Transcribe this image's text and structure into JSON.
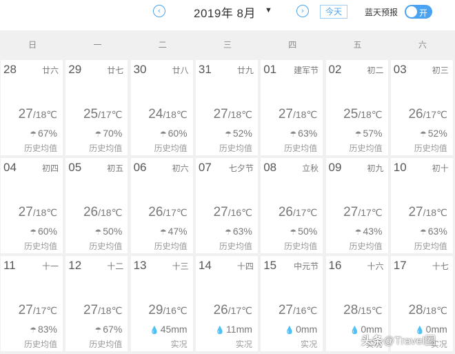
{
  "header": {
    "month_title": "2019年 8月",
    "caret": "▼",
    "prev_icon": "‹",
    "next_icon": "›",
    "today_label": "今天",
    "bluesky_label": "蓝天预报",
    "toggle_label": "开",
    "toggle_on": true,
    "accent_color": "#4aa3f0"
  },
  "weekdays": [
    "日",
    "一",
    "二",
    "三",
    "四",
    "五",
    "六"
  ],
  "precip_icons": {
    "chance": "☂",
    "amount": "💧"
  },
  "calendar": [
    {
      "day": "28",
      "lunar": "廿六",
      "hi": "27",
      "lo": "/18℃",
      "precip": "67%",
      "note": "历史均值",
      "kind": "chance"
    },
    {
      "day": "29",
      "lunar": "廿七",
      "hi": "25",
      "lo": "/17℃",
      "precip": "70%",
      "note": "历史均值",
      "kind": "chance"
    },
    {
      "day": "30",
      "lunar": "廿八",
      "hi": "24",
      "lo": "/18℃",
      "precip": "60%",
      "note": "历史均值",
      "kind": "chance"
    },
    {
      "day": "31",
      "lunar": "廿九",
      "hi": "27",
      "lo": "/18℃",
      "precip": "52%",
      "note": "历史均值",
      "kind": "chance"
    },
    {
      "day": "01",
      "lunar": "建军节",
      "hi": "27",
      "lo": "/18℃",
      "precip": "63%",
      "note": "历史均值",
      "kind": "chance"
    },
    {
      "day": "02",
      "lunar": "初二",
      "hi": "25",
      "lo": "/18℃",
      "precip": "57%",
      "note": "历史均值",
      "kind": "chance"
    },
    {
      "day": "03",
      "lunar": "初三",
      "hi": "26",
      "lo": "/17℃",
      "precip": "52%",
      "note": "历史均值",
      "kind": "chance"
    },
    {
      "day": "04",
      "lunar": "初四",
      "hi": "27",
      "lo": "/18℃",
      "precip": "60%",
      "note": "历史均值",
      "kind": "chance"
    },
    {
      "day": "05",
      "lunar": "初五",
      "hi": "26",
      "lo": "/18℃",
      "precip": "50%",
      "note": "历史均值",
      "kind": "chance"
    },
    {
      "day": "06",
      "lunar": "初六",
      "hi": "26",
      "lo": "/17℃",
      "precip": "47%",
      "note": "历史均值",
      "kind": "chance"
    },
    {
      "day": "07",
      "lunar": "七夕节",
      "hi": "27",
      "lo": "/16℃",
      "precip": "63%",
      "note": "历史均值",
      "kind": "chance"
    },
    {
      "day": "08",
      "lunar": "立秋",
      "hi": "26",
      "lo": "/17℃",
      "precip": "50%",
      "note": "历史均值",
      "kind": "chance"
    },
    {
      "day": "09",
      "lunar": "初九",
      "hi": "27",
      "lo": "/17℃",
      "precip": "43%",
      "note": "历史均值",
      "kind": "chance"
    },
    {
      "day": "10",
      "lunar": "初十",
      "hi": "27",
      "lo": "/18℃",
      "precip": "63%",
      "note": "历史均值",
      "kind": "chance"
    },
    {
      "day": "11",
      "lunar": "十一",
      "hi": "27",
      "lo": "/17℃",
      "precip": "83%",
      "note": "历史均值",
      "kind": "chance"
    },
    {
      "day": "12",
      "lunar": "十二",
      "hi": "27",
      "lo": "/18℃",
      "precip": "67%",
      "note": "历史均值",
      "kind": "chance"
    },
    {
      "day": "13",
      "lunar": "十三",
      "hi": "29",
      "lo": "/16℃",
      "precip": "45mm",
      "note": "实况",
      "kind": "amount"
    },
    {
      "day": "14",
      "lunar": "十四",
      "hi": "26",
      "lo": "/17℃",
      "precip": "11mm",
      "note": "实况",
      "kind": "amount"
    },
    {
      "day": "15",
      "lunar": "中元节",
      "hi": "27",
      "lo": "/16℃",
      "precip": "0mm",
      "note": "实况",
      "kind": "amount"
    },
    {
      "day": "16",
      "lunar": "十六",
      "hi": "28",
      "lo": "/15℃",
      "precip": "0mm",
      "note": "实况",
      "kind": "amount"
    },
    {
      "day": "17",
      "lunar": "十七",
      "hi": "28",
      "lo": "/18℃",
      "precip": "0mm",
      "note": "实况",
      "kind": "amount"
    }
  ],
  "watermark": {
    "prefix": "头条",
    "text": "@Travel圈"
  }
}
